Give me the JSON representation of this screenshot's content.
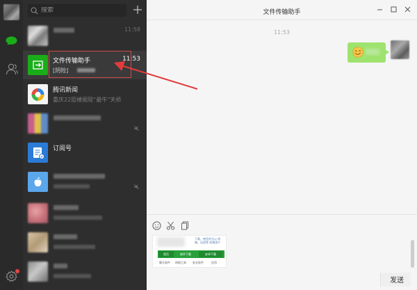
{
  "search": {
    "placeholder": "搜索"
  },
  "conversations": [
    {
      "name": "",
      "preview": "",
      "time": "11:58"
    },
    {
      "name": "文件传输助手",
      "preview": "[阴险]",
      "time": "11:53"
    },
    {
      "name": "腾讯新闻",
      "preview": "重庆22层楼阁现“最牛”天桥",
      "time": ""
    },
    {
      "name": "",
      "preview": "",
      "time": ""
    },
    {
      "name": "订阅号",
      "preview": "",
      "time": ""
    },
    {
      "name": "",
      "preview": "",
      "time": ""
    },
    {
      "name": "",
      "preview": "",
      "time": ""
    },
    {
      "name": "",
      "preview": "",
      "time": ""
    },
    {
      "name": "",
      "preview": "",
      "time": ""
    }
  ],
  "chat": {
    "title": "文件传输助手",
    "message_time": "11:53",
    "send_label": "发送"
  },
  "thumbnail": {
    "top_text": "下载，使用并且以 前端、动态等 前端用户",
    "seg1": "首页",
    "seg2": "软件下载",
    "seg3": "安卓下载",
    "bottom1": "聊天软件",
    "bottom2": "网络工具",
    "bottom3": "安全软件",
    "bottom4": "应用"
  },
  "colors": {
    "rail_bg": "#2a2a2a",
    "list_bg": "#2e2e2e",
    "bubble_green": "#9fe36f",
    "highlight_red": "#d44a4a",
    "accent_green": "#1aad19"
  }
}
